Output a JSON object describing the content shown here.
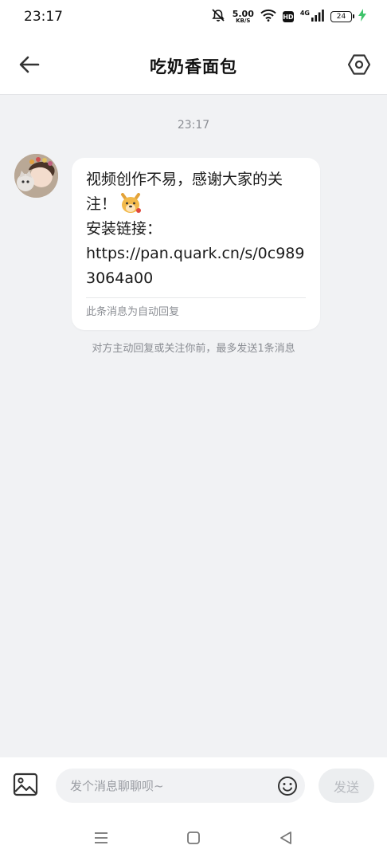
{
  "status_bar": {
    "time": "23:17",
    "net_speed_value": "5.00",
    "net_speed_unit": "KB/S",
    "hd_label": "HD",
    "signal_label": "4G",
    "battery_level": "24",
    "icons": [
      "mute-icon",
      "wifi-icon",
      "signal-icon",
      "battery-icon",
      "charging-icon"
    ]
  },
  "header": {
    "title": "吃奶香面包",
    "back_icon": "arrow-left-icon",
    "settings_icon": "hexagon-settings-icon"
  },
  "chat": {
    "timestamp": "23:17",
    "message": {
      "text": "视频创作不易，感谢大家的关注！",
      "line2": "安装链接：",
      "line3": "https://pan.quark.cn/s/0c9893064a00",
      "emoji": "dog-face-emoji",
      "auto_reply_note": "此条消息为自动回复"
    },
    "limit_note": "对方主动回复或关注你前，最多发送1条消息"
  },
  "input_bar": {
    "placeholder": "发个消息聊聊呗~",
    "send_label": "发送",
    "image_icon": "image-icon",
    "emoji_icon": "smiley-icon"
  },
  "nav": {
    "icons": [
      "menu-icon",
      "home-square-icon",
      "back-triangle-icon"
    ]
  },
  "colors": {
    "background": "#f1f2f4",
    "bubble": "#ffffff",
    "muted_text": "#8a8d93",
    "charging": "#3fc36b"
  }
}
